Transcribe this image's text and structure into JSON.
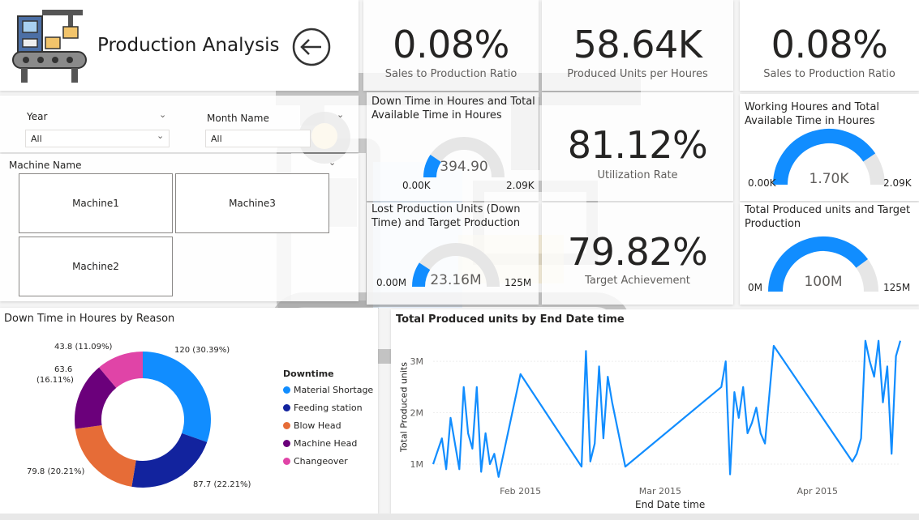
{
  "header": {
    "title": "Production Analysis",
    "back_icon": "back-arrow-icon",
    "logo_icon": "factory-conveyor-icon"
  },
  "kpis": {
    "sales_ratio_1": {
      "value": "0.08%",
      "label": "Sales to Production Ratio"
    },
    "produced_per_hour": {
      "value": "58.64K",
      "label": "Produced Units per Houres"
    },
    "sales_ratio_2": {
      "value": "0.08%",
      "label": "Sales to Production Ratio"
    },
    "utilization": {
      "value": "81.12%",
      "label": "Utilization Rate"
    },
    "target_achievement": {
      "value": "79.82%",
      "label": "Target Achievement"
    }
  },
  "gauges": {
    "downtime": {
      "title": "Down Time in Houres and Total Available Time in Houres",
      "min": "0.00K",
      "max": "2.09K",
      "value": "394.90",
      "fraction": 0.189,
      "color": "#118DFF"
    },
    "lost_units": {
      "title": "Lost Production Units (Down Time) and Target Production",
      "min": "0.00M",
      "max": "125M",
      "value": "23.16M",
      "fraction": 0.185,
      "color": "#118DFF"
    },
    "working_hours": {
      "title": "Working Houres and Total Available Time in Houres",
      "min": "0.00K",
      "max": "2.09K",
      "value": "1.70K",
      "fraction": 0.811,
      "color": "#118DFF"
    },
    "produced_target": {
      "title": "Total Produced units and Target Production",
      "min": "0M",
      "max": "125M",
      "value": "100M",
      "fraction": 0.8,
      "color": "#118DFF"
    }
  },
  "filters": {
    "year": {
      "label": "Year",
      "value": "All"
    },
    "month": {
      "label": "Month Name",
      "value": "All"
    },
    "machine": {
      "label": "Machine Name",
      "tiles": [
        "Machine1",
        "Machine3",
        "Machine2"
      ]
    }
  },
  "donut": {
    "title": "Down Time in Houres by Reason",
    "legend_title": "Downtime",
    "labels": [
      "120 (30.39%)",
      "87.7 (22.21%)",
      "79.8 (20.21%)",
      "63.6",
      "(16.11%)",
      "43.8 (11.09%)"
    ]
  },
  "line": {
    "title": "Total Produced units by End Date time",
    "xlabel": "End Date time",
    "ylabel": "Total Produced units"
  },
  "chart_data": [
    {
      "type": "pie",
      "title": "Down Time in Houres by Reason",
      "categories": [
        "Material Shortage",
        "Feeding station",
        "Blow Head",
        "Machine Head",
        "Changeover"
      ],
      "values": [
        120,
        87.7,
        79.8,
        63.6,
        43.8
      ],
      "percents": [
        30.39,
        22.21,
        20.21,
        16.11,
        11.09
      ],
      "colors": [
        "#118DFF",
        "#12239E",
        "#E66C37",
        "#6B007B",
        "#E044A7"
      ],
      "legend": "right"
    },
    {
      "type": "line",
      "title": "Total Produced units by End Date time",
      "xlabel": "End Date time",
      "ylabel": "Total Produced units",
      "x_ticks": [
        "Feb 2015",
        "Mar 2015",
        "Apr 2015"
      ],
      "y_ticks": [
        "1M",
        "2M",
        "3M"
      ],
      "ylim": [
        0.7,
        3.6
      ],
      "color": "#118DFF",
      "x": [
        0,
        2,
        3,
        4,
        6,
        7,
        8,
        9,
        10,
        11,
        12,
        13,
        14,
        15,
        20,
        34,
        35,
        36,
        37,
        38,
        39,
        40,
        41,
        44,
        66,
        67,
        68,
        69,
        70,
        71,
        72,
        73,
        74,
        75,
        76,
        78,
        96,
        97,
        98,
        99,
        100,
        101,
        102,
        103,
        104,
        105,
        106,
        107
      ],
      "values": [
        1.0,
        1.5,
        0.9,
        1.9,
        0.9,
        2.5,
        1.6,
        1.3,
        2.5,
        0.85,
        1.6,
        1.0,
        1.2,
        0.75,
        2.75,
        0.95,
        3.2,
        1.05,
        1.4,
        2.9,
        1.5,
        2.7,
        2.2,
        0.95,
        2.5,
        3.0,
        0.8,
        2.4,
        1.9,
        2.5,
        1.6,
        1.8,
        2.1,
        1.6,
        1.4,
        3.3,
        1.05,
        1.2,
        1.5,
        3.4,
        3.0,
        2.7,
        3.4,
        2.2,
        2.9,
        1.2,
        3.1,
        3.4
      ]
    }
  ],
  "colors": {
    "accent": "#118DFF",
    "track": "#E6E6E6"
  }
}
